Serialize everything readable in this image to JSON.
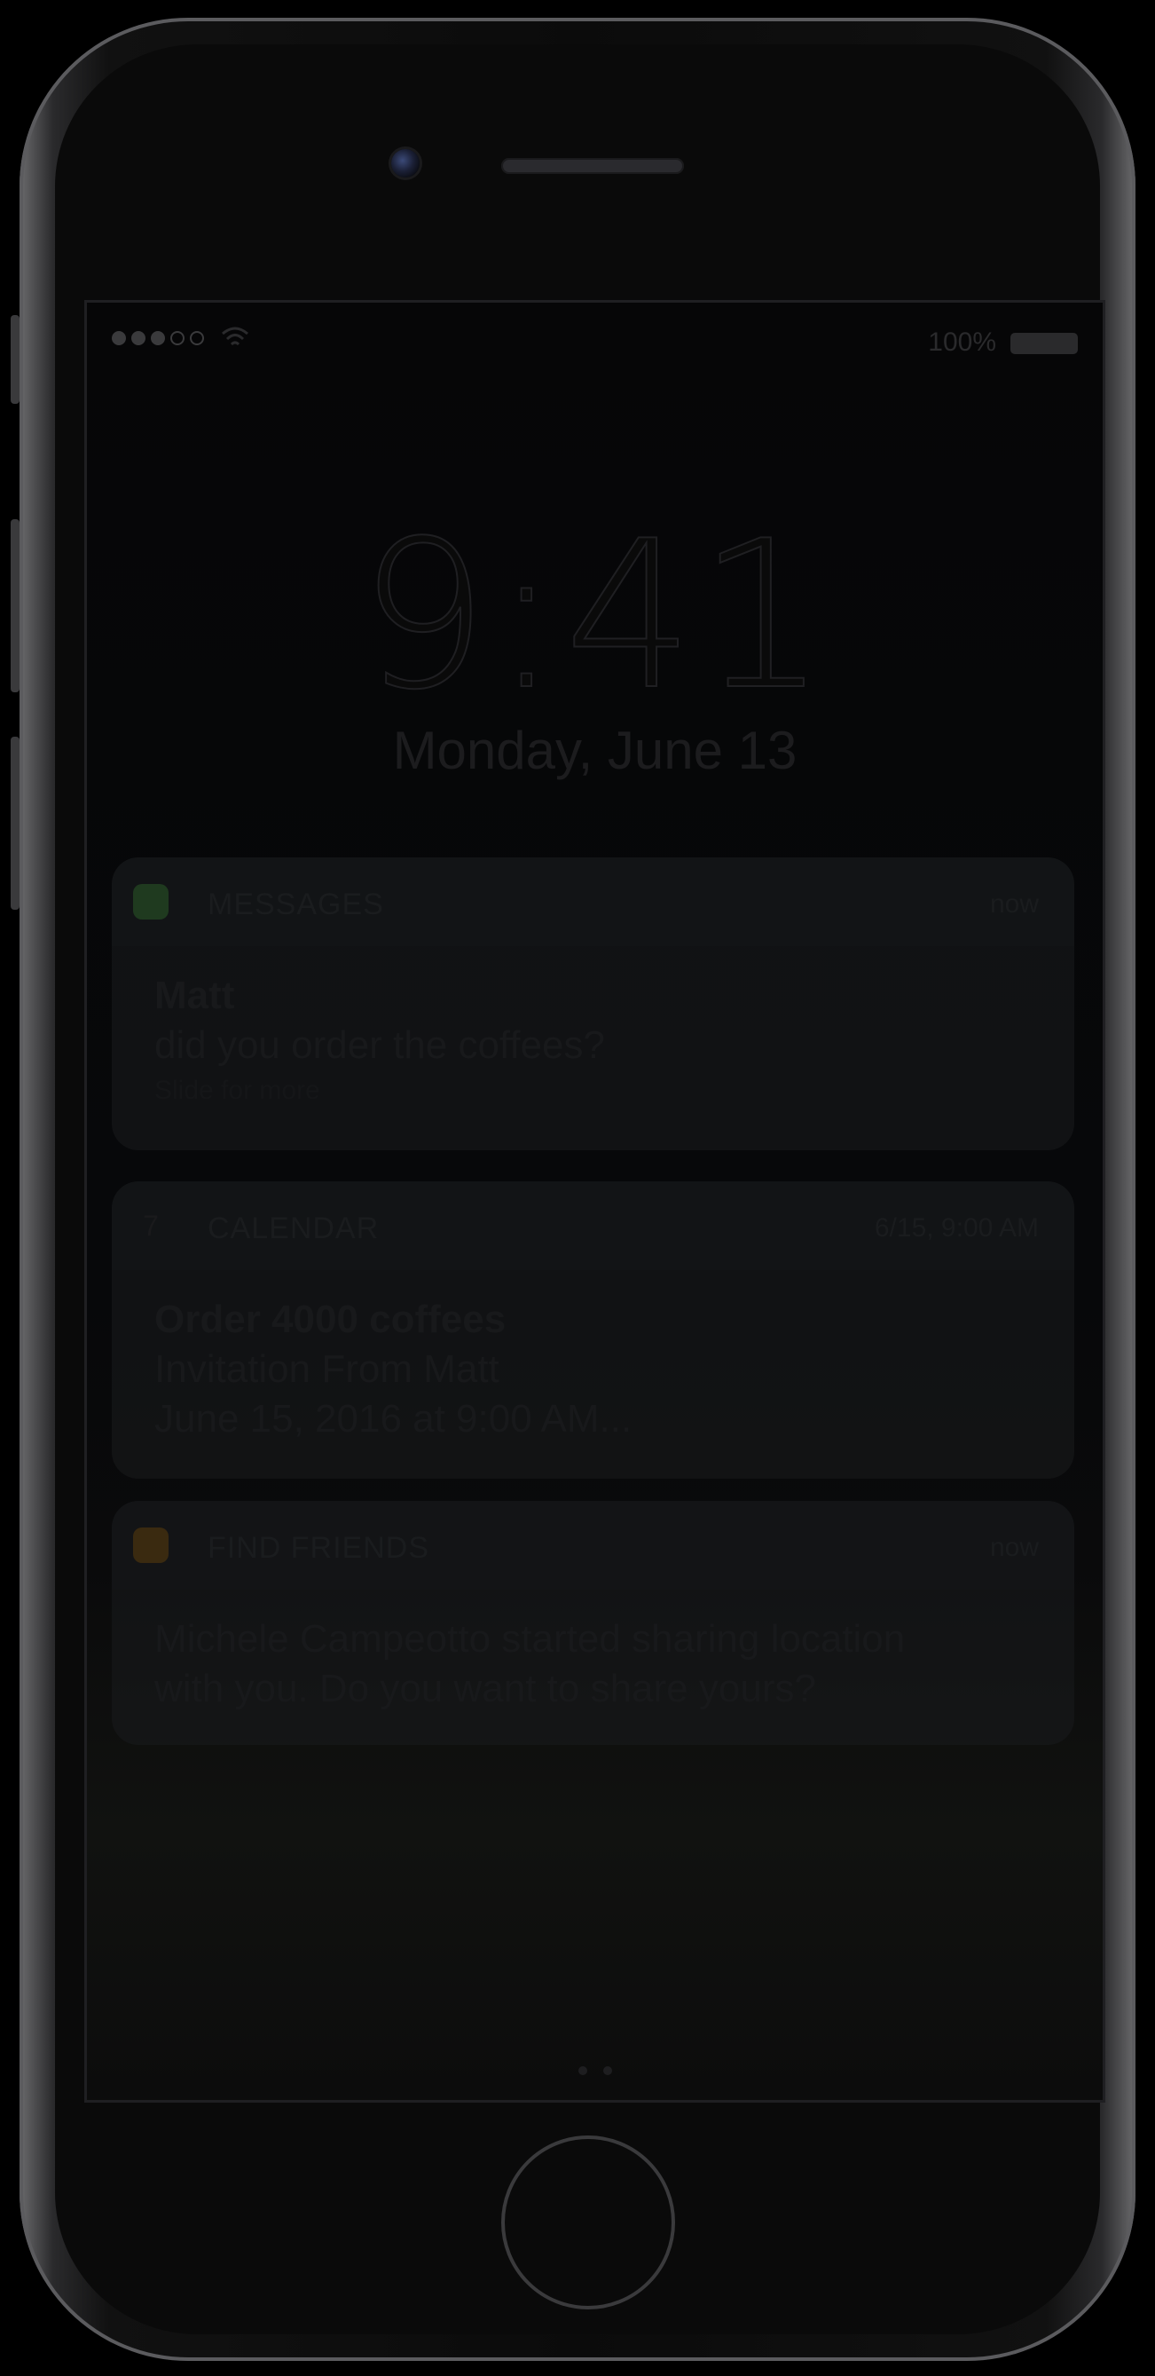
{
  "status_bar": {
    "battery_text": "100%",
    "signal_icon": "signal-dots-icon",
    "wifi_icon": "wifi-icon",
    "battery_icon": "battery-icon"
  },
  "lock_screen": {
    "time": "9:41",
    "date": "Monday, June 13"
  },
  "notifications": [
    {
      "app": "MESSAGES",
      "time": "now",
      "icon": "messages-icon",
      "icon_color": "#1f3a1f",
      "lines": [
        "Matt",
        "did you order the coffees?"
      ],
      "hint": "Slide for more"
    },
    {
      "app": "CALENDAR",
      "time": "6/15, 9:00 AM",
      "icon": "calendar-icon",
      "icon_color": "#1a1a1c",
      "icon_text": "7",
      "lines": [
        "Order 4000 coffees",
        "Invitation From Matt",
        "June 15, 2016 at 9:00 AM..."
      ]
    },
    {
      "app": "FIND FRIENDS",
      "time": "now",
      "icon": "find-friends-icon",
      "icon_color": "#3a2a10",
      "lines": [
        "Michele Campeotto started sharing location",
        "with you. Do you want to share yours?"
      ]
    }
  ],
  "colors": {
    "frame": "#5b5b5e",
    "screen_bg": "#060607"
  }
}
